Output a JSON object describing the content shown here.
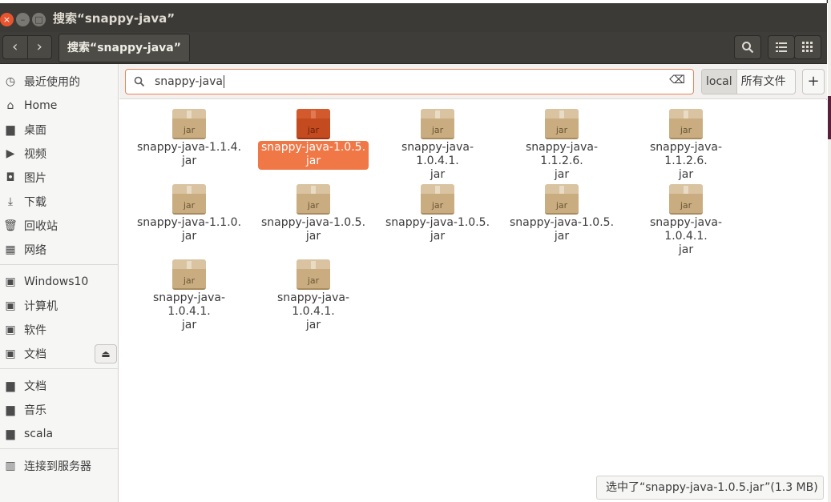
{
  "window": {
    "title": "搜索“snappy-java”",
    "controls": {
      "close": "×",
      "minimize": "–",
      "maximize": "□"
    }
  },
  "toolbar": {
    "back_icon": "‹",
    "forward_icon": "›",
    "breadcrumb": "搜索“snappy-java”",
    "search_icon": "⚲",
    "list_view_icon": "☰",
    "grid_view_icon": "⋮⋮⋮"
  },
  "sidebar": {
    "items": [
      {
        "label": "最近使用的",
        "icon": "recent-icon",
        "glyph": "◷"
      },
      {
        "label": "Home",
        "icon": "home-icon",
        "glyph": "⌂"
      },
      {
        "label": "桌面",
        "icon": "folder-icon",
        "glyph": "▆"
      },
      {
        "label": "视频",
        "icon": "video-icon",
        "glyph": "▶"
      },
      {
        "label": "图片",
        "icon": "camera-icon",
        "glyph": "◘"
      },
      {
        "label": "下载",
        "icon": "download-icon",
        "glyph": "⤓"
      },
      {
        "label": "回收站",
        "icon": "trash-icon",
        "glyph": "🗑"
      },
      {
        "label": "网络",
        "icon": "network-icon",
        "glyph": "▦"
      }
    ],
    "devices": [
      {
        "label": "Windows10",
        "icon": "drive-icon",
        "glyph": "▣"
      },
      {
        "label": "计算机",
        "icon": "drive-icon",
        "glyph": "▣"
      },
      {
        "label": "软件",
        "icon": "drive-icon",
        "glyph": "▣"
      },
      {
        "label": "文档",
        "icon": "drive-icon",
        "glyph": "▣"
      }
    ],
    "eject_glyph": "⏏",
    "bookmarks": [
      {
        "label": "文档",
        "icon": "folder-icon",
        "glyph": "▆"
      },
      {
        "label": "音乐",
        "icon": "folder-icon",
        "glyph": "▆"
      },
      {
        "label": "scala",
        "icon": "folder-icon",
        "glyph": "▆"
      }
    ],
    "connect": {
      "label": "连接到服务器",
      "icon": "server-icon",
      "glyph": "▥"
    }
  },
  "search": {
    "icon": "search-icon",
    "value": "snappy-java",
    "clear_icon": "⌫",
    "scope_local": "local",
    "scope_all": "所有文件",
    "add_label": "+"
  },
  "files": [
    {
      "line1": "snappy-java-1.1.4.",
      "line2": "jar",
      "selected": false
    },
    {
      "line1": "snappy-java-1.0.5.",
      "line2": "jar",
      "selected": true
    },
    {
      "line1": "snappy-java-1.0.4.1.",
      "line2": "jar",
      "selected": false
    },
    {
      "line1": "snappy-java-1.1.2.6.",
      "line2": "jar",
      "selected": false
    },
    {
      "line1": "snappy-java-1.1.2.6.",
      "line2": "jar",
      "selected": false
    },
    {
      "line1": "snappy-java-1.1.0.",
      "line2": "jar",
      "selected": false
    },
    {
      "line1": "snappy-java-1.0.5.",
      "line2": "jar",
      "selected": false
    },
    {
      "line1": "snappy-java-1.0.5.",
      "line2": "jar",
      "selected": false
    },
    {
      "line1": "snappy-java-1.0.5.",
      "line2": "jar",
      "selected": false
    },
    {
      "line1": "snappy-java-1.0.4.1.",
      "line2": "jar",
      "selected": false
    },
    {
      "line1": "snappy-java-1.0.4.1.",
      "line2": "jar",
      "selected": false
    },
    {
      "line1": "snappy-java-1.0.4.1.",
      "line2": "jar",
      "selected": false
    }
  ],
  "file_icon_label": "jar",
  "status": {
    "text": "选中了“snappy-java-1.0.5.jar”(1.3 MB)"
  },
  "colors": {
    "accent": "#f07746",
    "titlebar": "#3b3a36",
    "selected_box": "#c44a1f"
  }
}
